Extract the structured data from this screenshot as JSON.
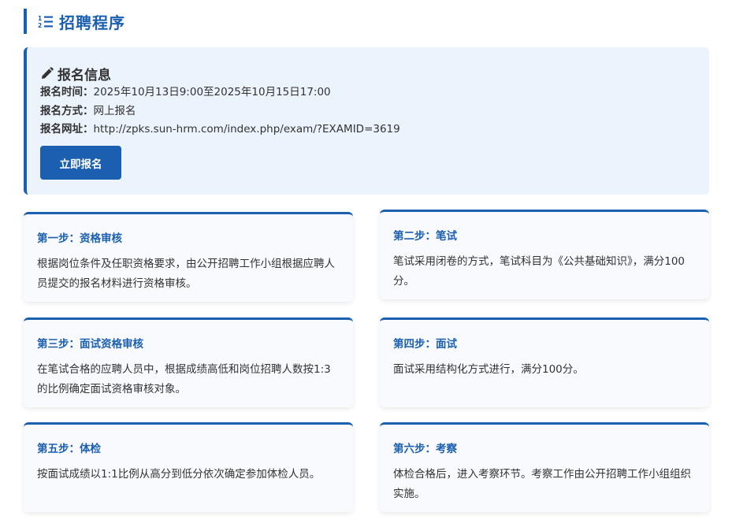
{
  "section": {
    "title": "招聘程序",
    "icon": "numbered-list-icon"
  },
  "registration": {
    "icon": "pencil-icon",
    "title": "报名信息",
    "time_label": "报名时间：",
    "time_value": "2025年10月13日9:00至2025年10月15日17:00",
    "method_label": "报名方式：",
    "method_value": "网上报名",
    "url_label": "报名网址：",
    "url_value": "http://zpks.sun-hrm.com/index.php/exam/?EXAMID=3619",
    "button_label": "立即报名"
  },
  "steps": [
    {
      "title": "第一步：资格审核",
      "desc": "根据岗位条件及任职资格要求，由公开招聘工作小组根据应聘人员提交的报名材料进行资格审核。"
    },
    {
      "title": "第二步：笔试",
      "desc": "笔试采用闭卷的方式，笔试科目为《公共基础知识》，满分100分。"
    },
    {
      "title": "第三步：面试资格审核",
      "desc": "在笔试合格的应聘人员中，根据成绩高低和岗位招聘人数按1:3的比例确定面试资格审核对象。"
    },
    {
      "title": "第四步：面试",
      "desc": "面试采用结构化方式进行，满分100分。"
    },
    {
      "title": "第五步：体检",
      "desc": "按面试成绩以1:1比例从高分到低分依次确定参加体检人员。"
    },
    {
      "title": "第六步：考察",
      "desc": "体检合格后，进入考察环节。考察工作由公开招聘工作小组组织实施。"
    }
  ],
  "colors": {
    "accent": "#1b5fb0",
    "panel_bg": "#ebf3fc",
    "card_bg": "#f8fafd",
    "text": "#333333"
  }
}
